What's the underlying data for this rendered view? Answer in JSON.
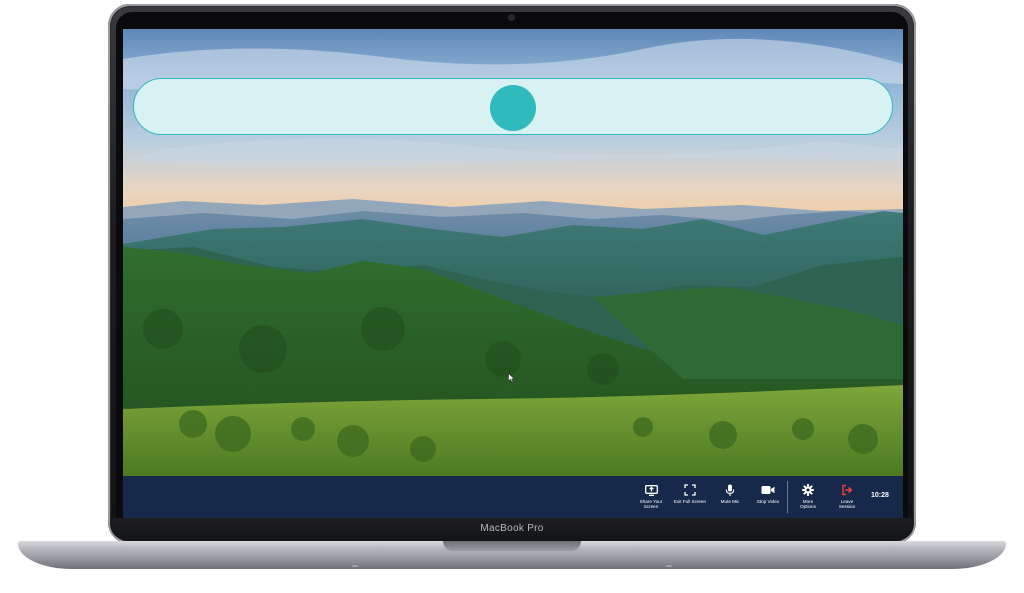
{
  "device": {
    "brand_label": "MacBook Pro"
  },
  "player": {
    "progress": 0.5
  },
  "toolbar": {
    "buttons": [
      {
        "label": "Share Your\nScreen",
        "icon": "share-screen-icon"
      },
      {
        "label": "Exit Full Screen",
        "icon": "exit-fullscreen-icon"
      },
      {
        "label": "Mute Mic",
        "icon": "microphone-icon"
      },
      {
        "label": "Stop Video",
        "icon": "video-camera-icon"
      },
      {
        "label": "More\nOptions",
        "icon": "gear-icon"
      },
      {
        "label": "Leave\nSession",
        "icon": "leave-icon"
      }
    ],
    "clock": "10:28",
    "colors": {
      "toolbar_bg": "#17294a",
      "accent": "#2fbbbe",
      "leave": "#e8443a"
    }
  }
}
